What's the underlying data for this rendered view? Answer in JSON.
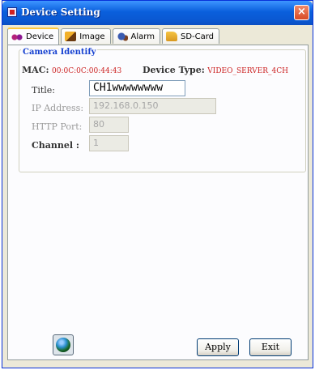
{
  "window": {
    "title": "Device Setting",
    "close_label": "×"
  },
  "tabs": [
    {
      "label": "Device",
      "icon": "device-icon",
      "active": true
    },
    {
      "label": "Image",
      "icon": "image-icon",
      "active": false
    },
    {
      "label": "Alarm",
      "icon": "alarm-icon",
      "active": false
    },
    {
      "label": "SD-Card",
      "icon": "sd-card-icon",
      "active": false
    }
  ],
  "camera_identify": {
    "group_title": "Camera Identify",
    "mac_label": "MAC:",
    "mac_value": "00:0C:0C:00:44:43",
    "device_type_label": "Device Type:",
    "device_type_value": "VIDEO_SERVER_4CH",
    "title_label": "Title:",
    "title_value": "CH1wwwwwwww",
    "ip_label": "IP Address:",
    "ip_value": "192.168.0.150",
    "http_port_label": "HTTP Port:",
    "http_port_value": "80",
    "channel_label": "Channel :",
    "channel_value": "1"
  },
  "buttons": {
    "apply_label": "Apply",
    "exit_label": "Exit"
  },
  "colors": {
    "titlebar": "#0a5fdc",
    "accent_red": "#cc2222",
    "group_title": "#1540d0"
  }
}
